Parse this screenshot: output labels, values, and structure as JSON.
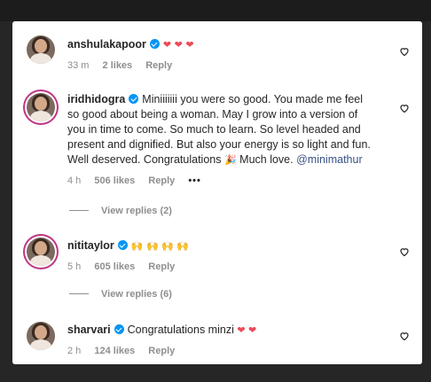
{
  "comments": [
    {
      "username": "anshulakapoor",
      "text_segments": [],
      "emoji": "❤ ❤ ❤",
      "time": "33 m",
      "likes": "2 likes",
      "reply": "Reply"
    },
    {
      "username": "iridhidogra",
      "lines": [
        "Miniiiiiii you were so good. You made me feel",
        "so good about being a woman. May I grow into a version of",
        "you in time to come. So much to learn. So level headed and",
        "present and dignified. But also your energy is so light and fun.",
        "Well deserved. Congratulations"
      ],
      "line5_emoji": "🎉",
      "line5_tail": "Much love.",
      "mention": "@minimathur",
      "time": "4 h",
      "likes": "506 likes",
      "reply": "Reply",
      "more": "•••",
      "view_replies": "View replies (2)"
    },
    {
      "username": "nititaylor",
      "emoji": "🙌 🙌 🙌 🙌",
      "time": "5 h",
      "likes": "605 likes",
      "reply": "Reply",
      "view_replies": "View replies (6)"
    },
    {
      "username": "sharvari",
      "text": "Congratulations minzi",
      "emoji": "❤ ❤",
      "time": "2 h",
      "likes": "124 likes",
      "reply": "Reply"
    }
  ],
  "icons": {
    "like": "heart-outline-icon",
    "verified": "verified-badge-icon"
  },
  "colors": {
    "verified": "#0095f6",
    "heart": "#ed4956",
    "mention": "#385185",
    "meta": "#8e8e8e",
    "backdrop": "#262626"
  }
}
